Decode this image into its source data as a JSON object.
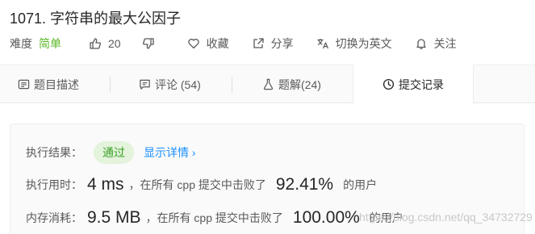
{
  "problem": {
    "title": "1071. 字符串的最大公因子",
    "difficulty_label": "难度",
    "difficulty_value": "简单",
    "likes": "20",
    "favorite_label": "收藏",
    "share_label": "分享",
    "switch_lang_label": "切换为英文",
    "follow_label": "关注"
  },
  "tabs": [
    {
      "label": "题目描述",
      "icon": "description-icon"
    },
    {
      "label": "评论 (54)",
      "icon": "comment-icon"
    },
    {
      "label": "题解(24)",
      "icon": "flask-icon"
    },
    {
      "label": "提交记录",
      "icon": "clock-icon"
    }
  ],
  "result": {
    "status_label": "执行结果：",
    "status_value": "通过",
    "details_link": "显示详情 ›",
    "runtime_label": "执行用时：",
    "runtime_value": "4 ms",
    "runtime_text": "，在所有 cpp 提交中击败了",
    "runtime_pct": "92.41%",
    "runtime_suffix": "的用户",
    "memory_label": "内存消耗：",
    "memory_value": "9.5 MB",
    "memory_text": "，在所有 cpp 提交中击败了",
    "memory_pct": "100.00%",
    "memory_suffix": "的用户"
  },
  "watermark": "https://blog.csdn.net/qq_34732729",
  "colors": {
    "accent_blue": "#1a90ff",
    "easy_green": "#5ab726",
    "badge_bg": "#e4f3dc",
    "badge_text": "#3aa126"
  }
}
